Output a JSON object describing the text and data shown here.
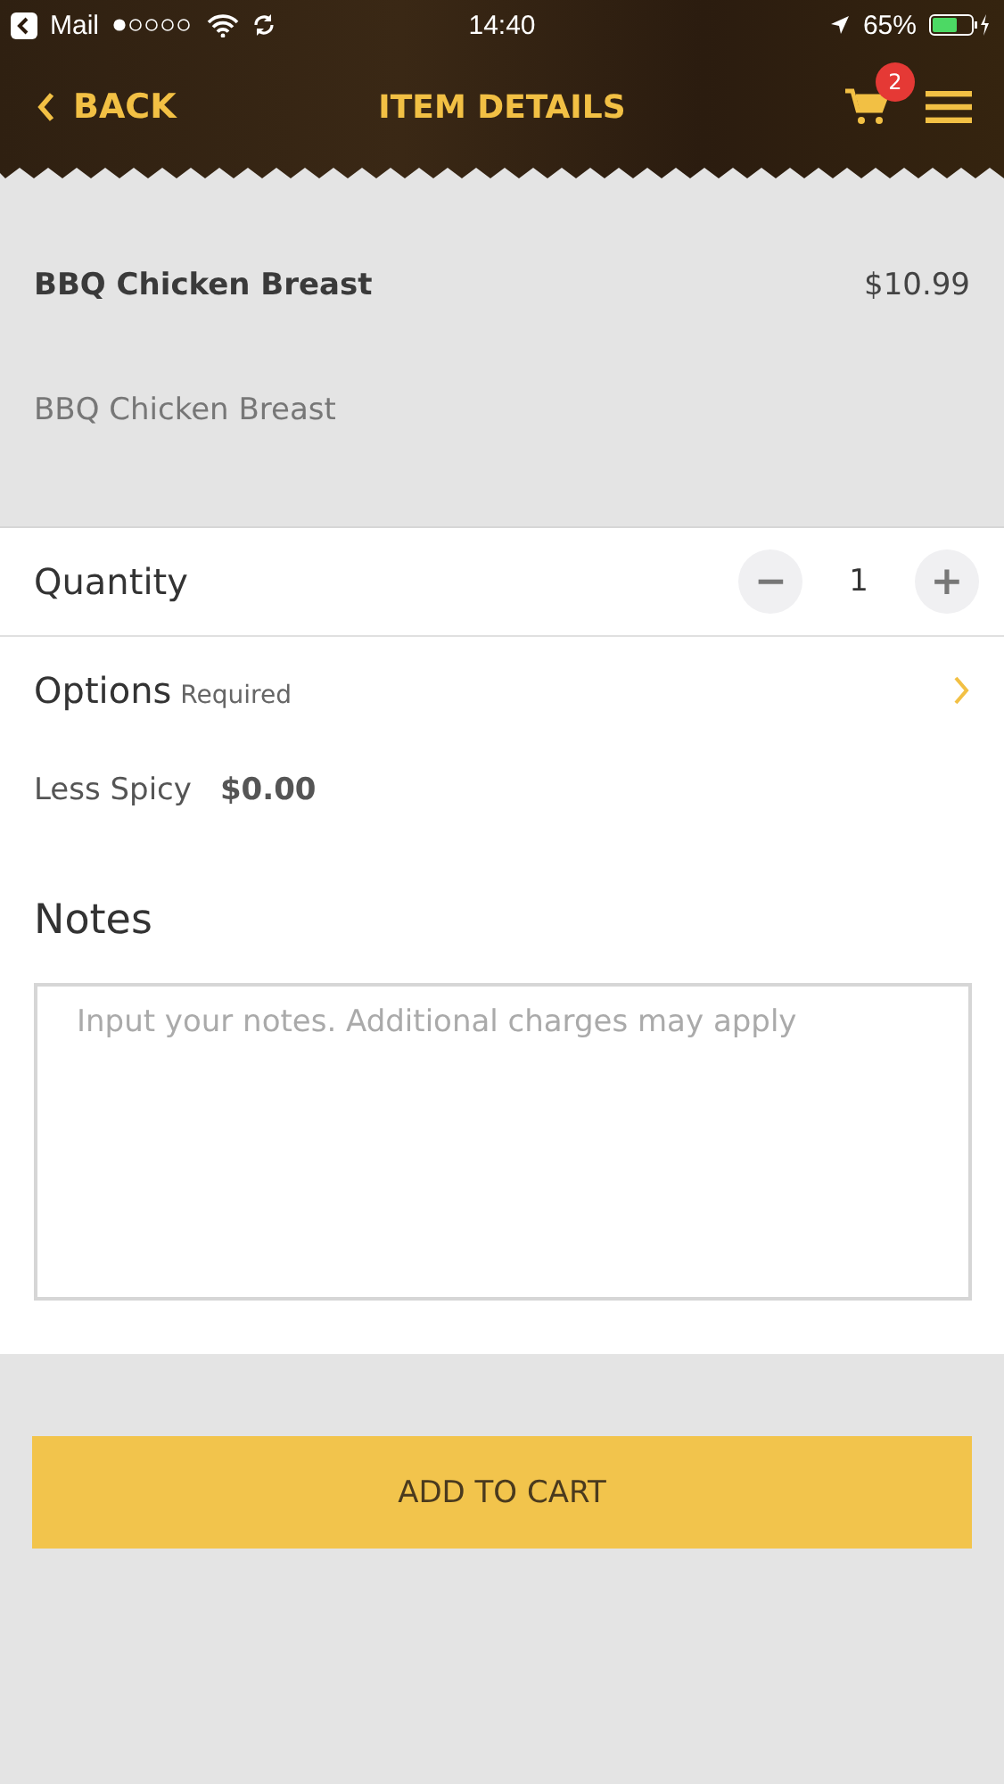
{
  "status_bar": {
    "back_app": "Mail",
    "time": "14:40",
    "battery": "65%"
  },
  "nav": {
    "back": "BACK",
    "title": "ITEM DETAILS",
    "cart_count": "2"
  },
  "item": {
    "name": "BBQ Chicken Breast",
    "price": "$10.99",
    "description": "BBQ Chicken Breast"
  },
  "quantity": {
    "label": "Quantity",
    "minus": "−",
    "value": "1",
    "plus": "+"
  },
  "options": {
    "label": "Options",
    "hint": "Required",
    "choices": [
      {
        "name": "Less Spicy",
        "price": "$0.00"
      }
    ]
  },
  "notes": {
    "label": "Notes",
    "placeholder": "Input your notes. Additional charges may apply"
  },
  "add_button": "ADD TO CART"
}
